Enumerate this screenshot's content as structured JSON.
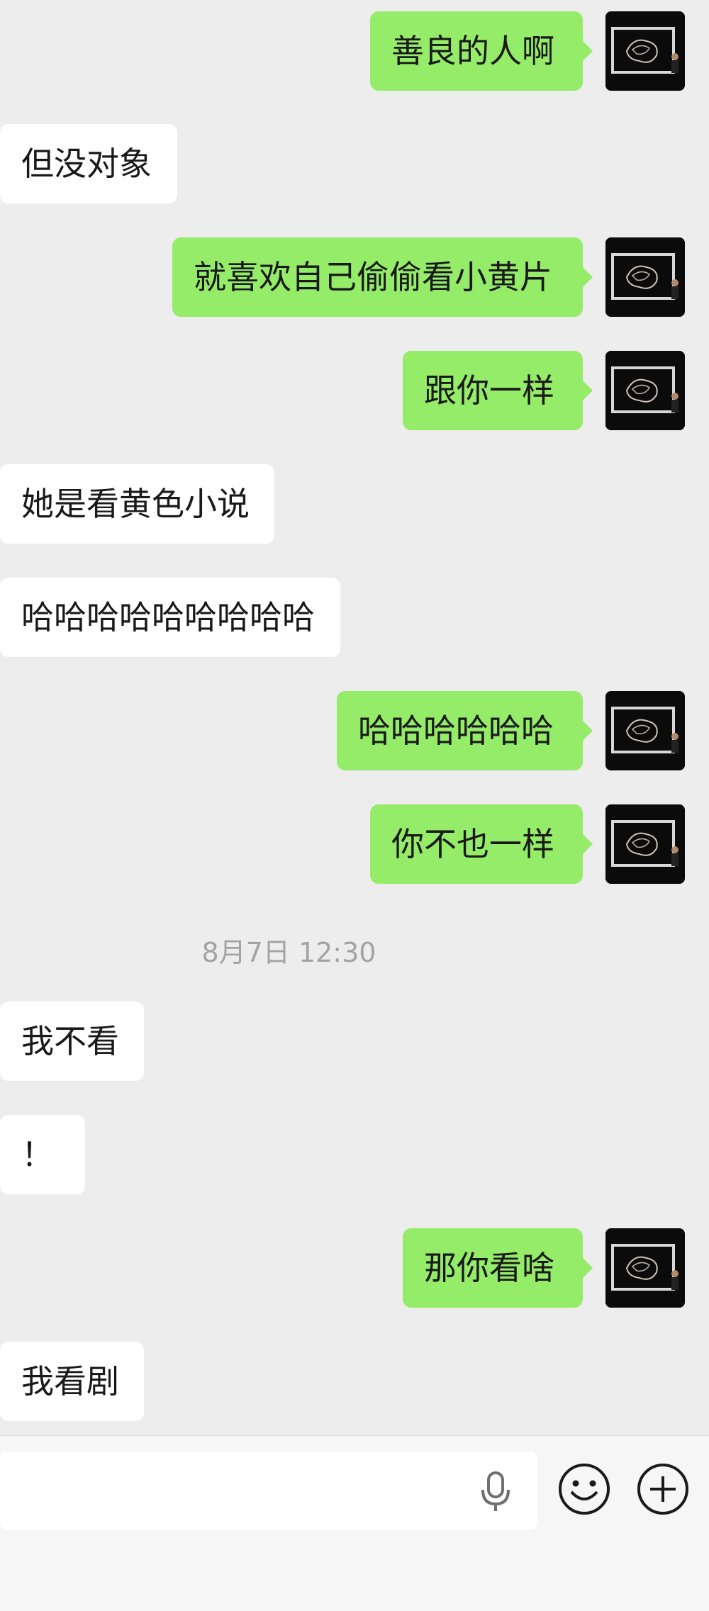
{
  "chat": {
    "messages": [
      {
        "side": "out",
        "text": "善良的人啊"
      },
      {
        "side": "in",
        "text": "但没对象"
      },
      {
        "side": "out",
        "text": "就喜欢自己偷偷看小黄片"
      },
      {
        "side": "out",
        "text": "跟你一样"
      },
      {
        "side": "in",
        "text": "她是看黄色小说"
      },
      {
        "side": "in",
        "text": "哈哈哈哈哈哈哈哈哈"
      },
      {
        "side": "out",
        "text": "哈哈哈哈哈哈"
      },
      {
        "side": "out",
        "text": "你不也一样"
      },
      {
        "side": "in",
        "text": "我不看"
      },
      {
        "side": "in",
        "text": "！"
      },
      {
        "side": "out",
        "text": "那你看啥"
      },
      {
        "side": "in",
        "text": "我看剧"
      }
    ],
    "timestamp": "8月7日 12:30"
  },
  "input_bar": {
    "text_value": "",
    "icons": [
      "microphone-icon",
      "emoji-icon",
      "plus-icon"
    ]
  },
  "colors": {
    "background": "#ededed",
    "outgoing_bubble": "#95ec69",
    "incoming_bubble": "#ffffff",
    "text": "#191919",
    "timestamp": "#a3a3a3"
  }
}
